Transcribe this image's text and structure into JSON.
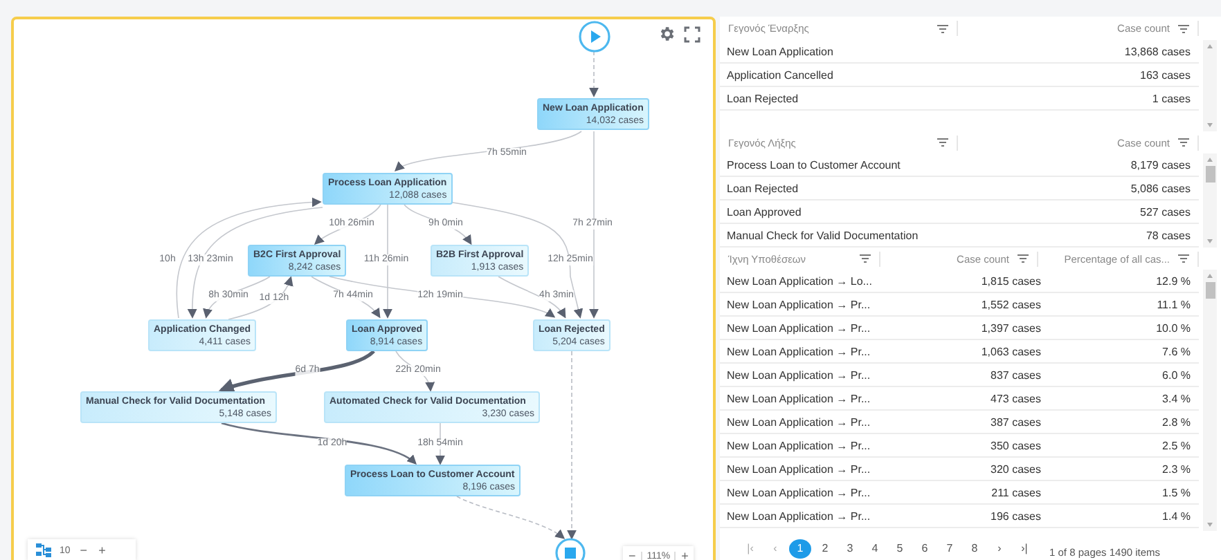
{
  "process_map": {
    "nodes": [
      {
        "name": "New Loan Application",
        "cases": "14,032 cases"
      },
      {
        "name": "Process Loan Application",
        "cases": "12,088 cases"
      },
      {
        "name": "B2C First Approval",
        "cases": "8,242 cases"
      },
      {
        "name": "B2B First Approval",
        "cases": "1,913 cases"
      },
      {
        "name": "Application Changed",
        "cases": "4,411 cases"
      },
      {
        "name": "Loan Approved",
        "cases": "8,914 cases"
      },
      {
        "name": "Loan Rejected",
        "cases": "5,204 cases"
      },
      {
        "name": "Manual Check for Valid Documentation",
        "cases": "5,148 cases"
      },
      {
        "name": "Automated Check for Valid Documentation",
        "cases": "3,230 cases"
      },
      {
        "name": "Process Loan to Customer Account",
        "cases": "8,196 cases"
      }
    ],
    "edges": [
      {
        "kind": "dashed"
      },
      {
        "kind": "normal",
        "label": "7h 55min"
      },
      {
        "kind": "normal",
        "label": "10h 26min"
      },
      {
        "kind": "normal",
        "label": "9h 0min"
      },
      {
        "kind": "normal",
        "label": "7h 27min"
      },
      {
        "kind": "normal",
        "label": "10h"
      },
      {
        "kind": "normal",
        "label": "13h 23min"
      },
      {
        "kind": "normal",
        "label": "11h 26min"
      },
      {
        "kind": "normal",
        "label": "12h 25min"
      },
      {
        "kind": "normal",
        "label": "8h 30min"
      },
      {
        "kind": "normal",
        "label": "1d 12h"
      },
      {
        "kind": "normal",
        "label": "7h 44min"
      },
      {
        "kind": "normal",
        "label": "12h 19min"
      },
      {
        "kind": "normal",
        "label": "4h 3min"
      },
      {
        "kind": "heavy",
        "label": "6d 7h"
      },
      {
        "kind": "normal",
        "label": "22h 20min"
      },
      {
        "kind": "medium",
        "label": "1d 20h"
      },
      {
        "kind": "normal",
        "label": "18h 54min"
      },
      {
        "kind": "dashed"
      },
      {
        "kind": "dashed"
      }
    ],
    "toolbar": {
      "depth": "10",
      "minus": "−",
      "plus": "+"
    },
    "zoom": {
      "minus": "−",
      "value": "111%",
      "plus": "+"
    }
  },
  "start_events": {
    "columns": [
      "Γεγονός Έναρξης",
      "Case count"
    ],
    "rows": [
      [
        "New Loan Application",
        "13,868 cases"
      ],
      [
        "Application Cancelled",
        "163 cases"
      ],
      [
        "Loan Rejected",
        "1 cases"
      ]
    ]
  },
  "end_events": {
    "columns": [
      "Γεγονός Λήξης",
      "Case count"
    ],
    "rows": [
      [
        "Process Loan to Customer Account",
        "8,179 cases"
      ],
      [
        "Loan Rejected",
        "5,086 cases"
      ],
      [
        "Loan Approved",
        "527 cases"
      ],
      [
        "Manual Check for Valid Documentation",
        "78 cases"
      ]
    ]
  },
  "variants": {
    "columns": [
      "Ίχνη Υποθέσεων",
      "Case count",
      "Percentage of all cas..."
    ],
    "rows": [
      [
        "New Loan Application → Lo...",
        "1,815 cases",
        "12.9 %"
      ],
      [
        "New Loan Application → Pr...",
        "1,552 cases",
        "11.1 %"
      ],
      [
        "New Loan Application → Pr...",
        "1,397 cases",
        "10.0 %"
      ],
      [
        "New Loan Application → Pr...",
        "1,063 cases",
        "7.6 %"
      ],
      [
        "New Loan Application → Pr...",
        "837 cases",
        "6.0 %"
      ],
      [
        "New Loan Application → Pr...",
        "473 cases",
        "3.4 %"
      ],
      [
        "New Loan Application → Pr...",
        "387 cases",
        "2.8 %"
      ],
      [
        "New Loan Application → Pr...",
        "350 cases",
        "2.5 %"
      ],
      [
        "New Loan Application → Pr...",
        "320 cases",
        "2.3 %"
      ],
      [
        "New Loan Application → Pr...",
        "211 cases",
        "1.5 %"
      ],
      [
        "New Loan Application → Pr...",
        "196 cases",
        "1.4 %"
      ]
    ]
  },
  "pagination": {
    "first": "|‹",
    "prev": "‹",
    "pages": [
      {
        "label": "1",
        "selected": true
      },
      {
        "label": "2",
        "selected": false
      },
      {
        "label": "3",
        "selected": false
      },
      {
        "label": "4",
        "selected": false
      },
      {
        "label": "5",
        "selected": false
      },
      {
        "label": "6",
        "selected": false
      },
      {
        "label": "7",
        "selected": false
      },
      {
        "label": "8",
        "selected": false
      }
    ],
    "next": "›",
    "last": "›|",
    "info": "1 of 8 pages 1490 items"
  }
}
